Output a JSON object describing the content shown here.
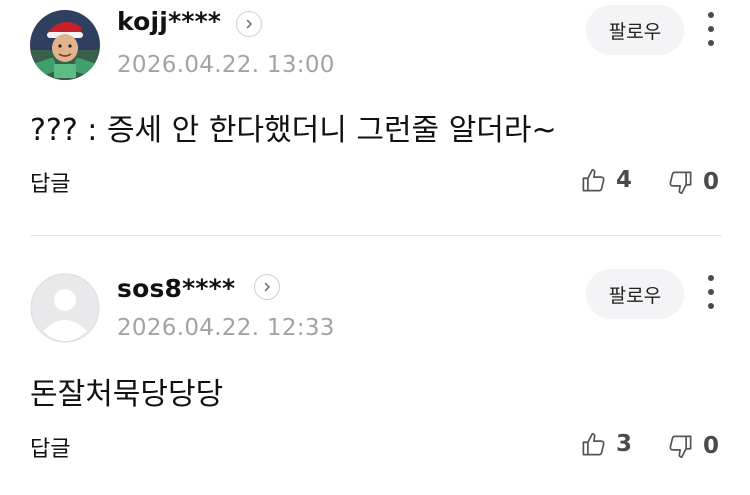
{
  "comments": [
    {
      "username": "kojj****",
      "timestamp": "2026.04.22. 13:00",
      "follow_label": "팔로우",
      "text": "??? : 증세 안 한다했더니 그런줄 알더라~",
      "reply_label": "답글",
      "likes": "4",
      "dislikes": "0",
      "avatar_icon": "user-avatar-photo"
    },
    {
      "username": "sos8****",
      "timestamp": "2026.04.22. 12:33",
      "follow_label": "팔로우",
      "text": "돈잘처묵당당당",
      "reply_label": "답글",
      "likes": "3",
      "dislikes": "0",
      "avatar_icon": "default-avatar-icon"
    }
  ],
  "colors": {
    "text": "#111111",
    "muted": "#a3a3a3",
    "count": "#4b4b4b",
    "follow_bg": "#f4f4f6",
    "divider": "#e7e7e7"
  }
}
